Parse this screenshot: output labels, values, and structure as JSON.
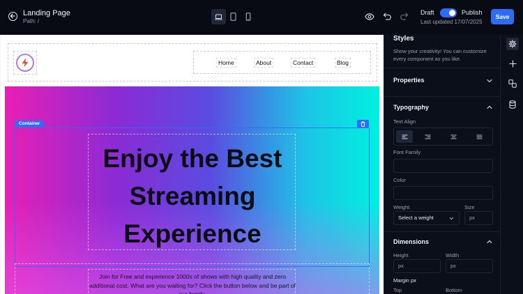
{
  "header": {
    "title": "Landing Page",
    "path": "Path: /",
    "draft_label": "Draft",
    "publish_label": "Publish",
    "last_updated": "Last updated 17/07/2025",
    "save_label": "Save",
    "publish_enabled": true,
    "devices": [
      "laptop-icon",
      "tablet-icon",
      "mobile-icon"
    ],
    "active_device": "laptop-icon"
  },
  "canvas": {
    "nav_links": [
      "Home",
      "About",
      "Contact",
      "Blog"
    ],
    "container_tag": "Container",
    "heading_lines": [
      "Enjoy the Best",
      "Streaming",
      "Experience"
    ],
    "paragraph": "Join for Free and experience 1000s of shows with high quality and zero additional cost. What are you waiting for? Click the button below and be part of our family.",
    "hero_colors": [
      "#e81fb5",
      "#8a2bd6",
      "#5a4ce0",
      "#1ec3e6",
      "#00f0e0"
    ],
    "accent": "#2d6df6"
  },
  "panel": {
    "title": "Styles",
    "description": "Show your creativity! You can customize every component as you like.",
    "properties": "Properties",
    "typography": "Typography",
    "text_align": "Text Align",
    "font_family": "Font Family",
    "color": "Color",
    "weight": "Weight",
    "weight_placeholder": "Select a weight",
    "size": "Size",
    "size_placeholder": "px",
    "dimensions": "Dimensions",
    "height": "Height",
    "height_placeholder": "px",
    "width": "Width",
    "width_placeholder": "px",
    "margin": "Margin px",
    "top": "Top",
    "bottom": "Bottom"
  },
  "rail": {
    "items": [
      "gear-icon",
      "plus-icon",
      "shapes-icon",
      "database-icon"
    ],
    "active": "gear-icon"
  }
}
